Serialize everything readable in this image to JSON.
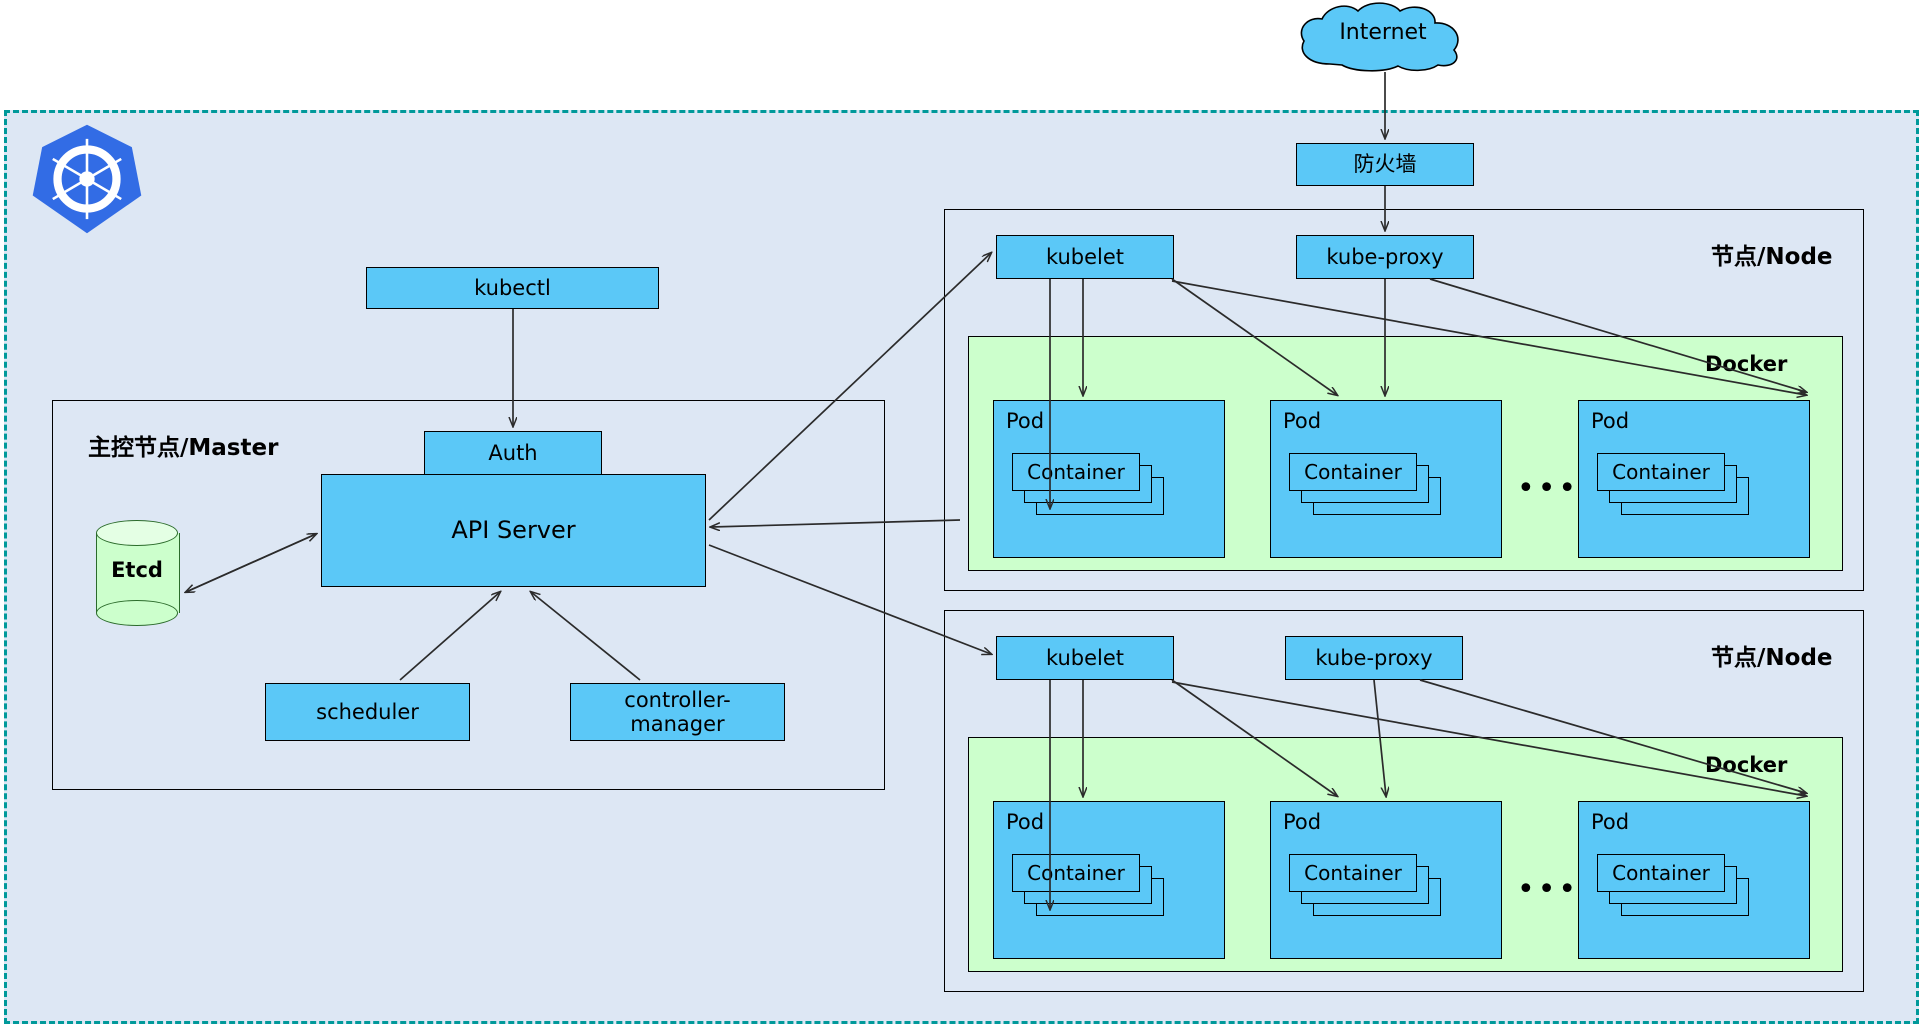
{
  "diagram": {
    "title": "Kubernetes Architecture",
    "colors": {
      "cluster_bg": "#dde7f4",
      "cluster_border": "#00999a",
      "box_blue": "#5bc8f7",
      "docker_green": "#ccffcc",
      "etcd_green": "#ccffcc",
      "k8s_logo_blue": "#326ce5",
      "line": "#2b2b2b"
    }
  },
  "internet": {
    "label": "Internet"
  },
  "firewall": {
    "label": "防火墙"
  },
  "logo": {
    "name": "kubernetes-logo"
  },
  "kubectl": {
    "label": "kubectl"
  },
  "master": {
    "label": "主控节点/Master",
    "etcd": "Etcd",
    "auth": "Auth",
    "api_server": "API Server",
    "scheduler": "scheduler",
    "controller_manager_line1": "controller-",
    "controller_manager_line2": "manager"
  },
  "nodes": [
    {
      "label": "节点/Node",
      "kubelet": "kubelet",
      "kube_proxy": "kube-proxy",
      "docker_label": "Docker",
      "ellipsis": "•••",
      "pods": [
        {
          "label": "Pod",
          "container": "Container"
        },
        {
          "label": "Pod",
          "container": "Container"
        },
        {
          "label": "Pod",
          "container": "Container"
        }
      ]
    },
    {
      "label": "节点/Node",
      "kubelet": "kubelet",
      "kube_proxy": "kube-proxy",
      "docker_label": "Docker",
      "ellipsis": "•••",
      "pods": [
        {
          "label": "Pod",
          "container": "Container"
        },
        {
          "label": "Pod",
          "container": "Container"
        },
        {
          "label": "Pod",
          "container": "Container"
        }
      ]
    }
  ]
}
